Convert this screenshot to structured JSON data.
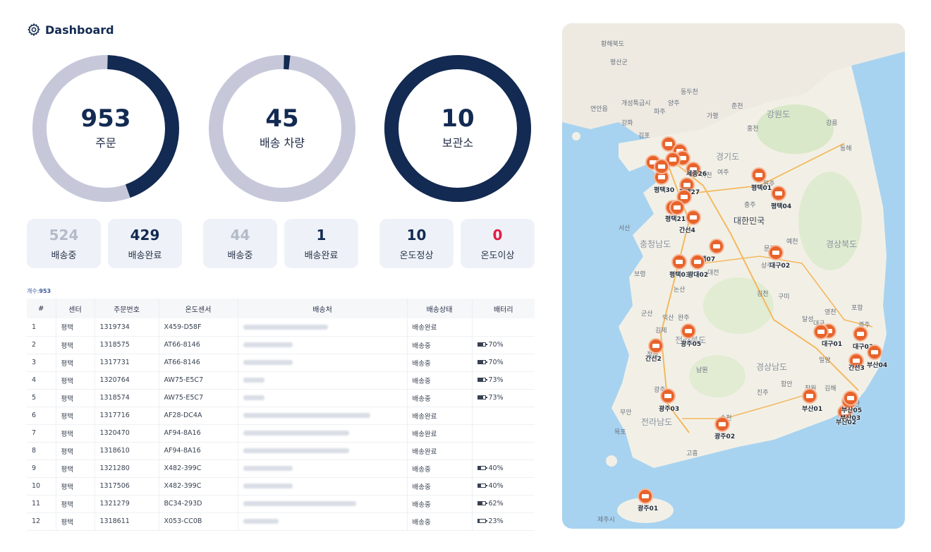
{
  "header": {
    "title": "Dashboard"
  },
  "donuts": [
    {
      "value": "953",
      "label": "주문",
      "fraction": 0.45
    },
    {
      "value": "45",
      "label": "배송 차량",
      "fraction": 0.022
    },
    {
      "value": "10",
      "label": "보관소",
      "fraction": 1.0
    }
  ],
  "stats": [
    {
      "value": "524",
      "label": "배송중"
    },
    {
      "value": "429",
      "label": "배송완료"
    },
    {
      "value": "44",
      "label": "배송중"
    },
    {
      "value": "1",
      "label": "배송완료"
    },
    {
      "value": "10",
      "label": "온도정상"
    },
    {
      "value": "0",
      "label": "온도이상"
    }
  ],
  "count": {
    "label": "개수:",
    "value": "953"
  },
  "table": {
    "headers": [
      "#",
      "센터",
      "주문번호",
      "온도센서",
      "배송처",
      "배송상태",
      "배터리"
    ],
    "rows": [
      {
        "no": "1",
        "center": "평택",
        "order": "1319734",
        "sensor": "X459-D58F",
        "status": "배송완료",
        "battery": ""
      },
      {
        "no": "2",
        "center": "평택",
        "order": "1318575",
        "sensor": "AT66-8146",
        "status": "배송중",
        "battery": "70%"
      },
      {
        "no": "3",
        "center": "평택",
        "order": "1317731",
        "sensor": "AT66-8146",
        "status": "배송중",
        "battery": "70%"
      },
      {
        "no": "4",
        "center": "평택",
        "order": "1320764",
        "sensor": "AW75-E5C7",
        "status": "배송중",
        "battery": "73%"
      },
      {
        "no": "5",
        "center": "평택",
        "order": "1318574",
        "sensor": "AW75-E5C7",
        "status": "배송중",
        "battery": "73%"
      },
      {
        "no": "6",
        "center": "평택",
        "order": "1317716",
        "sensor": "AF28-DC4A",
        "status": "배송완료",
        "battery": ""
      },
      {
        "no": "7",
        "center": "평택",
        "order": "1320470",
        "sensor": "AF94-8A16",
        "status": "배송완료",
        "battery": ""
      },
      {
        "no": "8",
        "center": "평택",
        "order": "1318610",
        "sensor": "AF94-8A16",
        "status": "배송완료",
        "battery": ""
      },
      {
        "no": "9",
        "center": "평택",
        "order": "1321280",
        "sensor": "X482-399C",
        "status": "배송중",
        "battery": "40%"
      },
      {
        "no": "10",
        "center": "평택",
        "order": "1317506",
        "sensor": "X482-399C",
        "status": "배송중",
        "battery": "40%"
      },
      {
        "no": "11",
        "center": "평택",
        "order": "1321279",
        "sensor": "BC34-293D",
        "status": "배송중",
        "battery": "62%"
      },
      {
        "no": "12",
        "center": "평택",
        "order": "1318611",
        "sensor": "X053-CC0B",
        "status": "배송중",
        "battery": "23%"
      }
    ]
  },
  "map": {
    "region_labels": [
      "황해북도",
      "평산군",
      "강원도",
      "경기도",
      "대한민국",
      "충청남도",
      "경상북도",
      "경상남도",
      "전라남도",
      "전라북도"
    ],
    "city_labels": [
      "개성특급시",
      "연안읍",
      "파주",
      "양주",
      "동두천",
      "가평",
      "춘천",
      "홍천",
      "강릉",
      "동해",
      "강화",
      "김포",
      "여주",
      "원주",
      "이천",
      "충주",
      "서산",
      "보령",
      "논산",
      "대전",
      "예천",
      "문경",
      "상주",
      "김천",
      "구미",
      "영천",
      "포항",
      "경주",
      "대구",
      "달성",
      "밀양",
      "김해",
      "창원",
      "진주",
      "함안",
      "남원",
      "완주",
      "군산",
      "익산",
      "김제",
      "정읍",
      "광주",
      "순천",
      "목포",
      "무안",
      "고흥",
      "제주시",
      "울산"
    ],
    "markers": [
      "평택01",
      "평택04",
      "평택07",
      "평택03",
      "평택30",
      "평택27",
      "간선4",
      "간선2",
      "간선3",
      "광주05",
      "광주03",
      "광주02",
      "광주01",
      "대구02",
      "대구01",
      "대구03",
      "부산01",
      "부산02",
      "부산03",
      "부산04",
      "부산05",
      "광대02",
      "세종26",
      "평택21"
    ]
  }
}
